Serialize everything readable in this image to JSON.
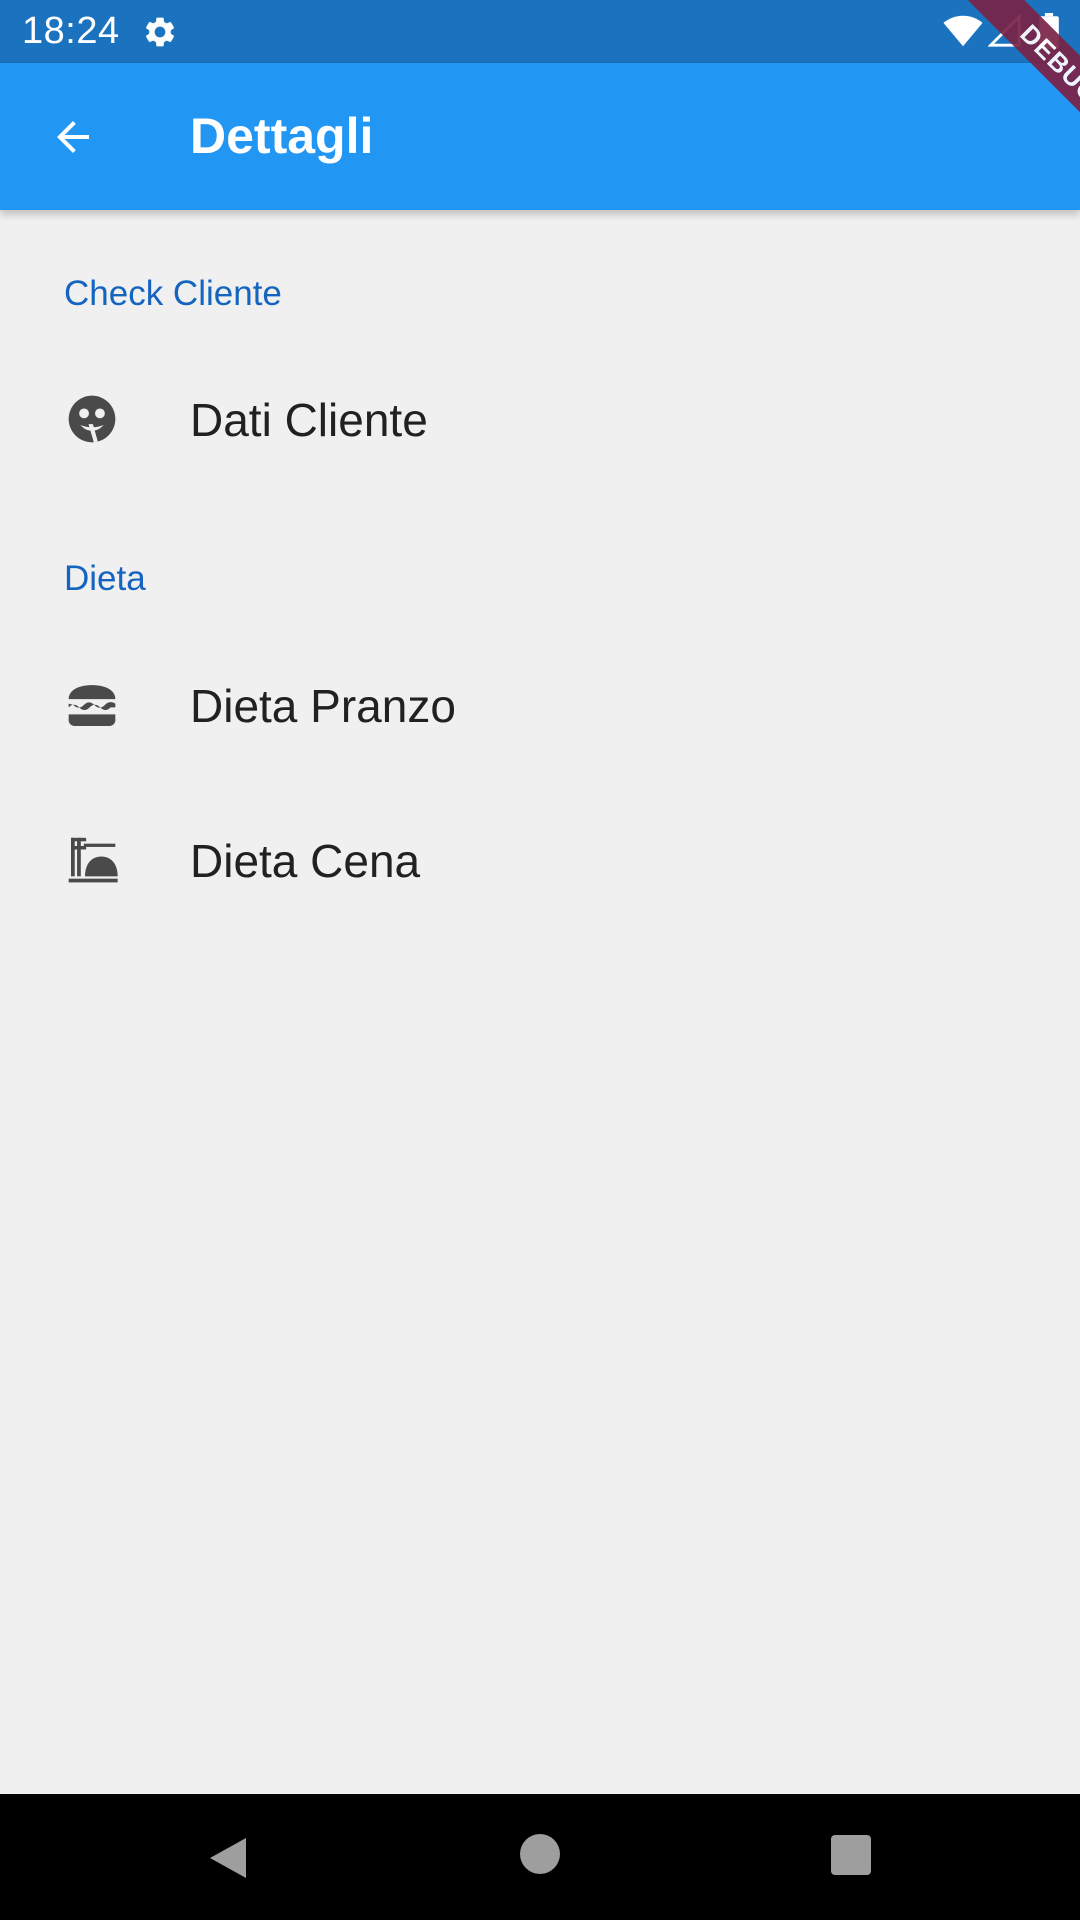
{
  "status_bar": {
    "time": "18:24",
    "icons": [
      "gear-icon",
      "wifi-icon",
      "signal-icon",
      "battery-icon"
    ]
  },
  "app_bar": {
    "title": "Dettagli",
    "back_icon": "arrow-back-icon",
    "background": "#2196f3"
  },
  "debug_banner": {
    "label": "DEBUG"
  },
  "sections": [
    {
      "header": "Check Cliente",
      "items": [
        {
          "label": "Dati Cliente",
          "icon": "face-icon"
        }
      ]
    },
    {
      "header": "Dieta",
      "items": [
        {
          "label": "Dieta Pranzo",
          "icon": "burger-icon"
        },
        {
          "label": "Dieta Cena",
          "icon": "dinner-icon"
        }
      ]
    }
  ],
  "colors": {
    "accent": "#1565c0",
    "status_bar": "#1b72be",
    "background": "#f0f0f0"
  },
  "nav_bar": {
    "icons": [
      "nav-back-icon",
      "nav-home-icon",
      "nav-recents-icon"
    ]
  }
}
